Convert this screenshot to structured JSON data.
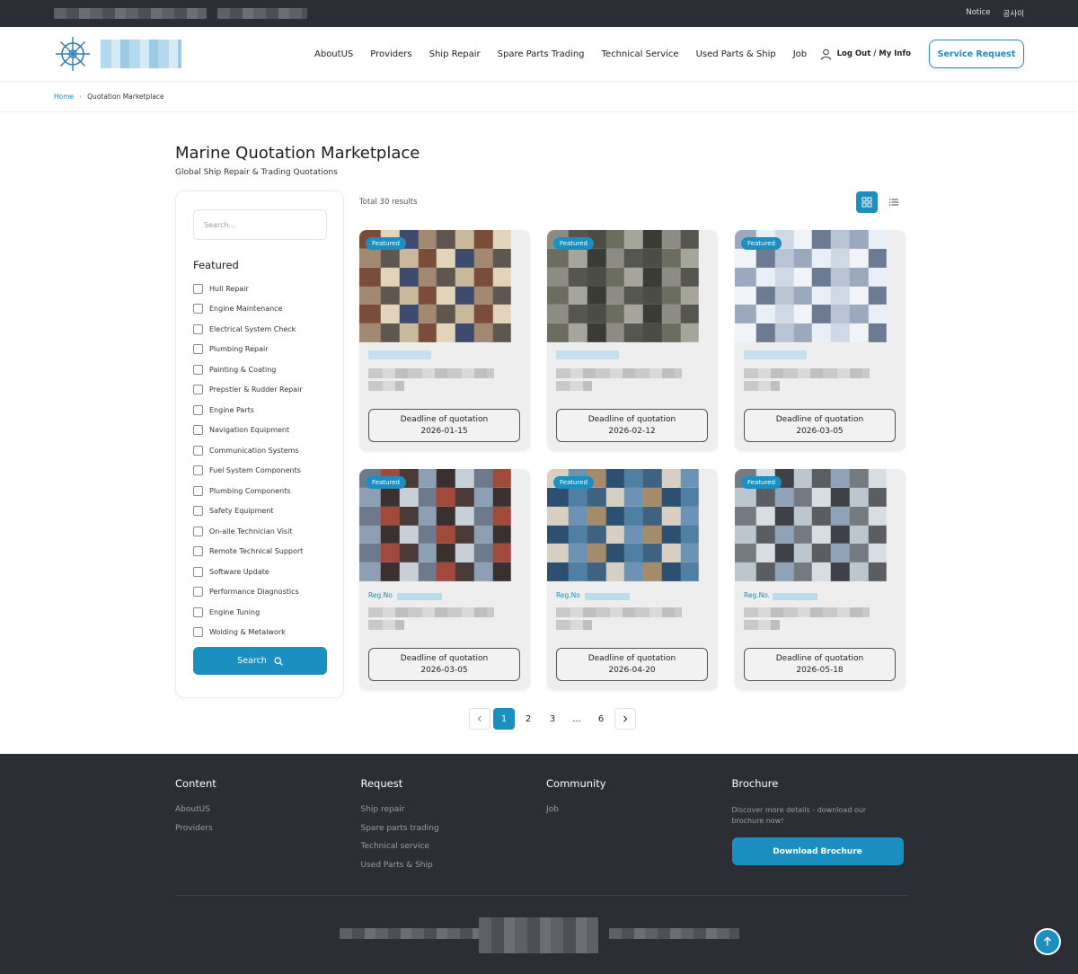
{
  "topbar": {
    "links": [
      "Notice",
      "공사이"
    ]
  },
  "header": {
    "nav": [
      "AboutUS",
      "Providers",
      "Ship Repair",
      "Spare Parts Trading",
      "Technical Service",
      "Used Parts & Ship",
      "Job"
    ],
    "user_label": "Log Out / My Info",
    "service_request": "Service Request"
  },
  "breadcrumb": {
    "home": "Home",
    "sep": "›",
    "current": "Quotation Marketplace"
  },
  "page": {
    "title": "Marine Quotation Marketplace",
    "subtitle": "Global Ship Repair & Trading Quotations"
  },
  "sidebar": {
    "search_placeholder": "Search...",
    "filter_title": "Featured",
    "filters": [
      "Hull Repair",
      "Engine Maintenance",
      "Electrical System Check",
      "Plumbing Repair",
      "Painting & Coating",
      "Prepstler & Rudder Repair",
      "Engine Parts",
      "Navigation Equipment",
      "Communication Systems",
      "Fuel System Components",
      "Plumbing Components",
      "Safety Equipment",
      "On-alle Technician Visit",
      "Remote Technical Support",
      "Software Update",
      "Performance Diagnostics",
      "Engine Tuning",
      "Wolding & Metalwork"
    ],
    "search_button": "Search"
  },
  "results": {
    "count_label": "Total 30 results"
  },
  "cards": [
    {
      "badge": "Featured",
      "regno": "",
      "deadline_label": "Deadline of quotation",
      "deadline": "2026-01-15"
    },
    {
      "badge": "Featured",
      "regno": "",
      "deadline_label": "Deadline of quotation",
      "deadline": "2026-02-12"
    },
    {
      "badge": "Featured",
      "regno": "",
      "deadline_label": "Deadline of quotation",
      "deadline": "2026-03-05"
    },
    {
      "badge": "Featured",
      "regno": "Reg.No",
      "deadline_label": "Deadline of quotation",
      "deadline": "2026-03-05"
    },
    {
      "badge": "Featured",
      "regno": "Reg.No",
      "deadline_label": "Deadline of quotation",
      "deadline": "2026-04-20"
    },
    {
      "badge": "Featured",
      "regno": "Reg.No.",
      "deadline_label": "Deadline of quotation",
      "deadline": "2026-05-18"
    }
  ],
  "pagination": {
    "pages": [
      "1",
      "2",
      "3",
      "...",
      "6"
    ],
    "active": "1"
  },
  "footer": {
    "content": {
      "title": "Content",
      "links": [
        "AboutUS",
        "Providers"
      ]
    },
    "request": {
      "title": "Request",
      "links": [
        "Ship repair",
        "Spare parts trading",
        "Technical service",
        "Used Parts & Ship"
      ]
    },
    "community": {
      "title": "Community",
      "links": [
        "Job"
      ]
    },
    "brochure": {
      "title": "Brochure",
      "text": "Discover more details - download our brochure now!",
      "button": "Download Brochure"
    }
  },
  "colors": {
    "accent": "#1b8fbf",
    "dark": "#2b2e34"
  }
}
